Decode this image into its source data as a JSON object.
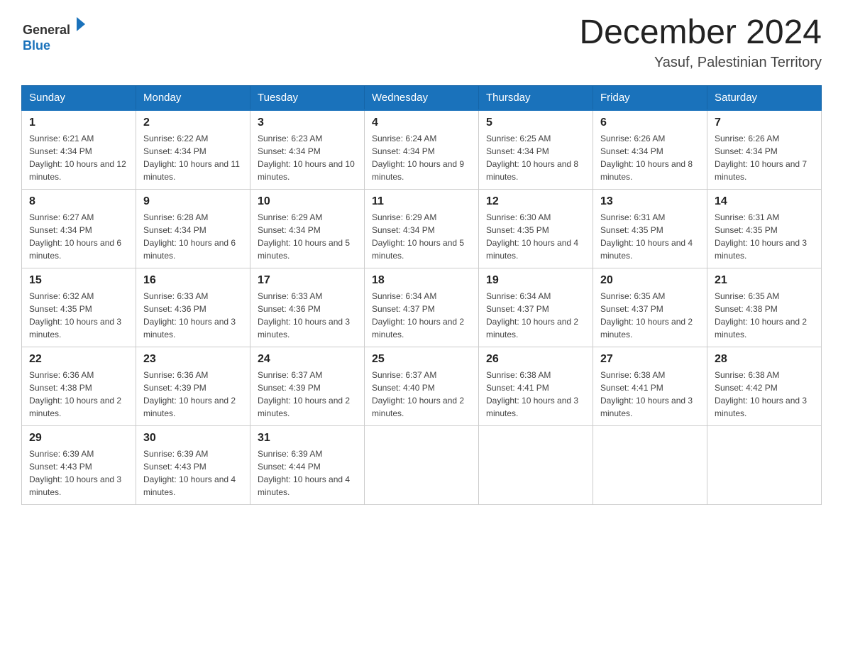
{
  "header": {
    "logo_text_general": "General",
    "logo_text_blue": "Blue",
    "month_title": "December 2024",
    "location": "Yasuf, Palestinian Territory"
  },
  "days_of_week": [
    "Sunday",
    "Monday",
    "Tuesday",
    "Wednesday",
    "Thursday",
    "Friday",
    "Saturday"
  ],
  "weeks": [
    [
      {
        "day": "1",
        "sunrise": "6:21 AM",
        "sunset": "4:34 PM",
        "daylight": "10 hours and 12 minutes."
      },
      {
        "day": "2",
        "sunrise": "6:22 AM",
        "sunset": "4:34 PM",
        "daylight": "10 hours and 11 minutes."
      },
      {
        "day": "3",
        "sunrise": "6:23 AM",
        "sunset": "4:34 PM",
        "daylight": "10 hours and 10 minutes."
      },
      {
        "day": "4",
        "sunrise": "6:24 AM",
        "sunset": "4:34 PM",
        "daylight": "10 hours and 9 minutes."
      },
      {
        "day": "5",
        "sunrise": "6:25 AM",
        "sunset": "4:34 PM",
        "daylight": "10 hours and 8 minutes."
      },
      {
        "day": "6",
        "sunrise": "6:26 AM",
        "sunset": "4:34 PM",
        "daylight": "10 hours and 8 minutes."
      },
      {
        "day": "7",
        "sunrise": "6:26 AM",
        "sunset": "4:34 PM",
        "daylight": "10 hours and 7 minutes."
      }
    ],
    [
      {
        "day": "8",
        "sunrise": "6:27 AM",
        "sunset": "4:34 PM",
        "daylight": "10 hours and 6 minutes."
      },
      {
        "day": "9",
        "sunrise": "6:28 AM",
        "sunset": "4:34 PM",
        "daylight": "10 hours and 6 minutes."
      },
      {
        "day": "10",
        "sunrise": "6:29 AM",
        "sunset": "4:34 PM",
        "daylight": "10 hours and 5 minutes."
      },
      {
        "day": "11",
        "sunrise": "6:29 AM",
        "sunset": "4:34 PM",
        "daylight": "10 hours and 5 minutes."
      },
      {
        "day": "12",
        "sunrise": "6:30 AM",
        "sunset": "4:35 PM",
        "daylight": "10 hours and 4 minutes."
      },
      {
        "day": "13",
        "sunrise": "6:31 AM",
        "sunset": "4:35 PM",
        "daylight": "10 hours and 4 minutes."
      },
      {
        "day": "14",
        "sunrise": "6:31 AM",
        "sunset": "4:35 PM",
        "daylight": "10 hours and 3 minutes."
      }
    ],
    [
      {
        "day": "15",
        "sunrise": "6:32 AM",
        "sunset": "4:35 PM",
        "daylight": "10 hours and 3 minutes."
      },
      {
        "day": "16",
        "sunrise": "6:33 AM",
        "sunset": "4:36 PM",
        "daylight": "10 hours and 3 minutes."
      },
      {
        "day": "17",
        "sunrise": "6:33 AM",
        "sunset": "4:36 PM",
        "daylight": "10 hours and 3 minutes."
      },
      {
        "day": "18",
        "sunrise": "6:34 AM",
        "sunset": "4:37 PM",
        "daylight": "10 hours and 2 minutes."
      },
      {
        "day": "19",
        "sunrise": "6:34 AM",
        "sunset": "4:37 PM",
        "daylight": "10 hours and 2 minutes."
      },
      {
        "day": "20",
        "sunrise": "6:35 AM",
        "sunset": "4:37 PM",
        "daylight": "10 hours and 2 minutes."
      },
      {
        "day": "21",
        "sunrise": "6:35 AM",
        "sunset": "4:38 PM",
        "daylight": "10 hours and 2 minutes."
      }
    ],
    [
      {
        "day": "22",
        "sunrise": "6:36 AM",
        "sunset": "4:38 PM",
        "daylight": "10 hours and 2 minutes."
      },
      {
        "day": "23",
        "sunrise": "6:36 AM",
        "sunset": "4:39 PM",
        "daylight": "10 hours and 2 minutes."
      },
      {
        "day": "24",
        "sunrise": "6:37 AM",
        "sunset": "4:39 PM",
        "daylight": "10 hours and 2 minutes."
      },
      {
        "day": "25",
        "sunrise": "6:37 AM",
        "sunset": "4:40 PM",
        "daylight": "10 hours and 2 minutes."
      },
      {
        "day": "26",
        "sunrise": "6:38 AM",
        "sunset": "4:41 PM",
        "daylight": "10 hours and 3 minutes."
      },
      {
        "day": "27",
        "sunrise": "6:38 AM",
        "sunset": "4:41 PM",
        "daylight": "10 hours and 3 minutes."
      },
      {
        "day": "28",
        "sunrise": "6:38 AM",
        "sunset": "4:42 PM",
        "daylight": "10 hours and 3 minutes."
      }
    ],
    [
      {
        "day": "29",
        "sunrise": "6:39 AM",
        "sunset": "4:43 PM",
        "daylight": "10 hours and 3 minutes."
      },
      {
        "day": "30",
        "sunrise": "6:39 AM",
        "sunset": "4:43 PM",
        "daylight": "10 hours and 4 minutes."
      },
      {
        "day": "31",
        "sunrise": "6:39 AM",
        "sunset": "4:44 PM",
        "daylight": "10 hours and 4 minutes."
      },
      null,
      null,
      null,
      null
    ]
  ]
}
